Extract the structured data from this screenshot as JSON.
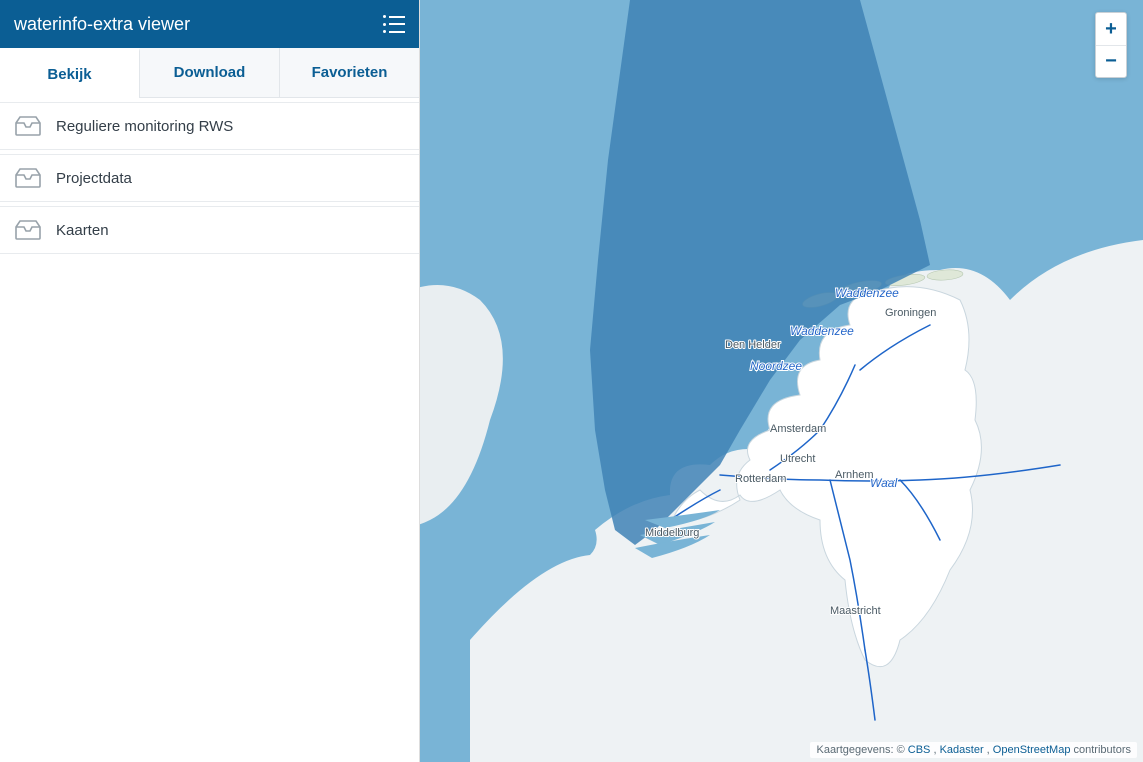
{
  "header": {
    "title": "waterinfo-extra viewer"
  },
  "tabs": [
    {
      "id": "bekijk",
      "label": "Bekijk",
      "active": true
    },
    {
      "id": "download",
      "label": "Download",
      "active": false
    },
    {
      "id": "favorieten",
      "label": "Favorieten",
      "active": false
    }
  ],
  "list_items": [
    {
      "id": "reguliere-monitoring-rws",
      "label": "Reguliere monitoring RWS"
    },
    {
      "id": "projectdata",
      "label": "Projectdata"
    },
    {
      "id": "kaarten",
      "label": "Kaarten"
    }
  ],
  "map": {
    "water_labels": {
      "noordzee": "Noordzee",
      "waddenzee1": "Waddenzee",
      "waddenzee2": "Waddenzee",
      "waal": "Waal"
    },
    "city_labels": {
      "groningen": "Groningen",
      "denhelder": "Den Helder",
      "amsterdam": "Amsterdam",
      "utrecht": "Utrecht",
      "arnhem": "Arnhem",
      "rotterdam": "Rotterdam",
      "middelburg": "Middelburg",
      "maastricht": "Maastricht"
    },
    "attribution": {
      "prefix": "Kaartgegevens: © ",
      "link1": "CBS",
      "sep1": ", ",
      "link2": "Kadaster",
      "sep2": ", ",
      "link3": "OpenStreetMap",
      "suffix": " contributors"
    },
    "zoom": {
      "in": "+",
      "out": "−"
    }
  }
}
